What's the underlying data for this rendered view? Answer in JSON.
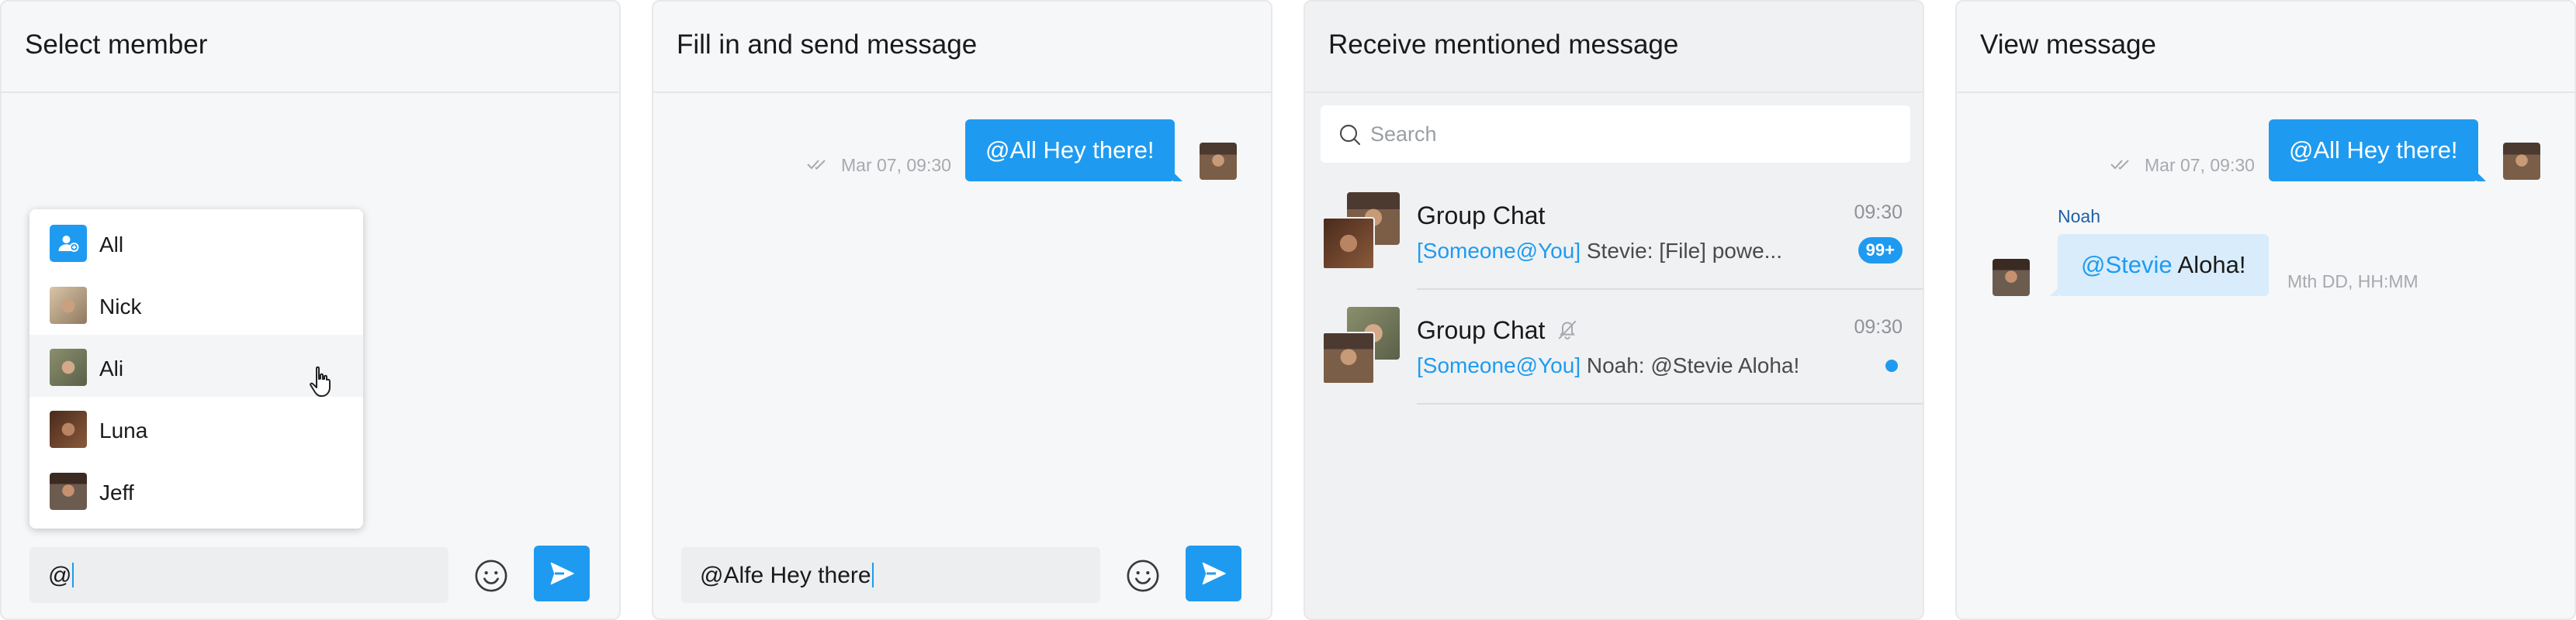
{
  "panels": {
    "select_member": {
      "title": "Select member",
      "members": [
        {
          "label": "All",
          "icon": "group-icon"
        },
        {
          "label": "Nick",
          "icon": "avatar"
        },
        {
          "label": "Ali",
          "icon": "avatar"
        },
        {
          "label": "Luna",
          "icon": "avatar"
        },
        {
          "label": "Jeff",
          "icon": "avatar"
        }
      ],
      "hovered_member": "Ali",
      "input_value": "@"
    },
    "fill_send": {
      "title": "Fill in and send message",
      "message_time": "Mar 07, 09:30",
      "message_text": "@All Hey there!",
      "input_value": "@Alfe Hey there"
    },
    "receive": {
      "title": "Receive mentioned message",
      "search_placeholder": "Search",
      "conversations": [
        {
          "name": "Group Chat",
          "tag": "[Someone@You]",
          "preview": " Stevie: [File] powe...",
          "time": "09:30",
          "badge": "99+",
          "muted": false
        },
        {
          "name": "Group Chat",
          "tag": "[Someone@You]",
          "preview": "  Noah: @Stevie Aloha!",
          "time": "09:30",
          "badge": "",
          "muted": true
        }
      ]
    },
    "view": {
      "title": "View message",
      "sent_time": "Mar 07, 09:30",
      "sent_text": "@All Hey there!",
      "sender": "Noah",
      "received_mention": "@Stevie",
      "received_text": " Aloha!",
      "received_time": "Mth DD, HH:MM"
    }
  },
  "colors": {
    "accent": "#1e9bf0",
    "panel_bg": "#f6f7f8",
    "list_bg": "#f0f1f3",
    "incoming_bubble": "#d8ecfb",
    "sender_name": "#1c5fa8"
  }
}
